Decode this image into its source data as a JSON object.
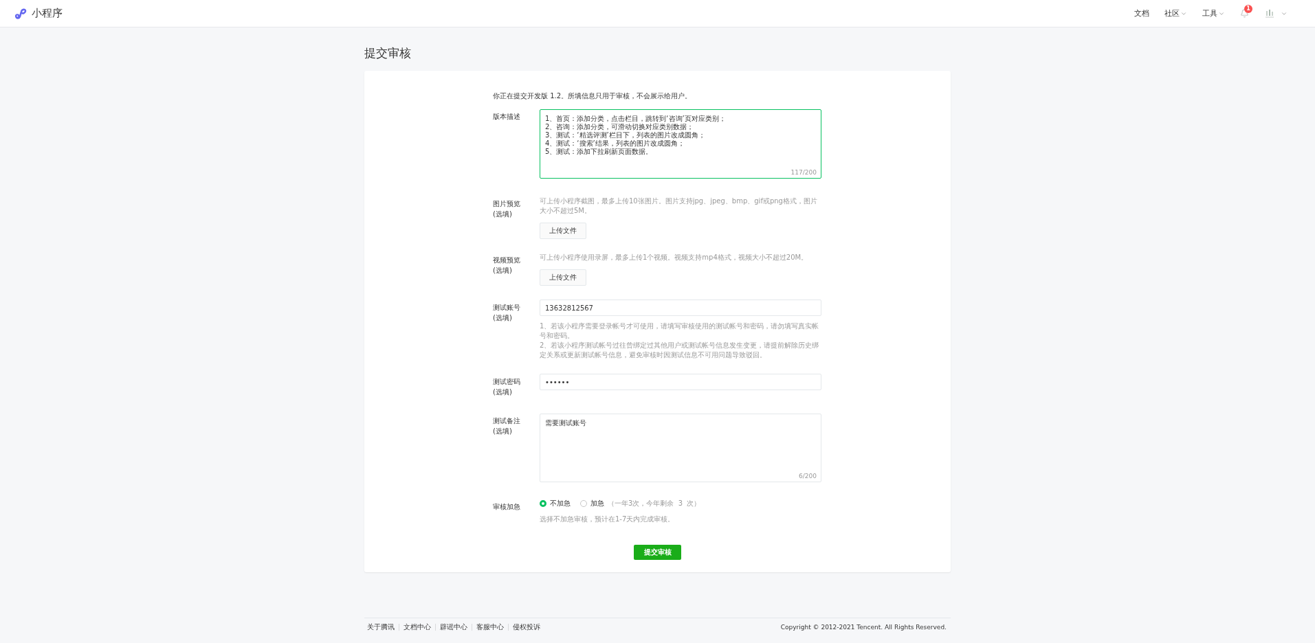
{
  "header": {
    "logo_text": "小程序",
    "nav": [
      {
        "label": "文档",
        "dropdown": false
      },
      {
        "label": "社区",
        "dropdown": true
      },
      {
        "label": "工具",
        "dropdown": true
      }
    ],
    "notification_count": "1"
  },
  "page_title": "提交审核",
  "intro": "你正在提交开发版 1.2。所填信息只用于审核，不会展示给用户。",
  "fields": [
    {
      "kind": "textarea",
      "label": "版本描述",
      "value": "1、首页：添加分类，点击栏目，跳转到‘咨询’页对应类别；\n2、咨询：添加分类，可滑动切换对应类别数据；\n3、测试：‘精选评测’栏目下，列表的图片改成圆角；\n4、测试：‘搜索’结果，列表的图片改成圆角；\n5、测试：添加下拉刷新页面数据。",
      "counter": "117/200",
      "focused": true
    },
    {
      "kind": "upload",
      "label": "图片预览",
      "optional": "(选填)",
      "hint": "可上传小程序截图，最多上传10张图片。图片支持jpg、jpeg、bmp、gif或png格式，图片大小不超过5M。",
      "button": "上传文件"
    },
    {
      "kind": "upload",
      "label": "视频预览",
      "optional": "(选填)",
      "hint": "可上传小程序使用录屏，最多上传1个视频。视频支持mp4格式，视频大小不超过20M。",
      "button": "上传文件"
    },
    {
      "kind": "input",
      "label": "测试账号",
      "optional": "(选填)",
      "value": "13632812567",
      "notes": [
        "1、若该小程序需要登录帐号才可使用，请填写审核使用的测试帐号和密码，请勿填写真实帐号和密码。",
        "2、若该小程序测试帐号过往曾绑定过其他用户或测试帐号信息发生变更，请提前解除历史绑定关系或更新测试帐号信息，避免审核时因测试信息不可用问题导致驳回。"
      ]
    },
    {
      "kind": "input",
      "label": "测试密码",
      "optional": "(选填)",
      "value": "••••••"
    },
    {
      "kind": "textarea",
      "label": "测试备注",
      "optional": "(选填)",
      "value": "需要测试账号",
      "counter": "6/200",
      "focused": false
    },
    {
      "kind": "radio",
      "label": "审核加急",
      "options": [
        {
          "label": "不加急",
          "selected": true
        },
        {
          "label": "加急",
          "note": "（一年3次，今年剩余  3  次）",
          "selected": false
        }
      ],
      "hint": "选择不加急审核，预计在1-7天内完成审核。"
    }
  ],
  "submit": "提交审核",
  "footer": {
    "links": [
      "关于腾讯",
      "文档中心",
      "辟谣中心",
      "客服中心",
      "侵权投诉"
    ],
    "copyright": "Copyright © 2012-2021 Tencent. All Rights Reserved."
  }
}
